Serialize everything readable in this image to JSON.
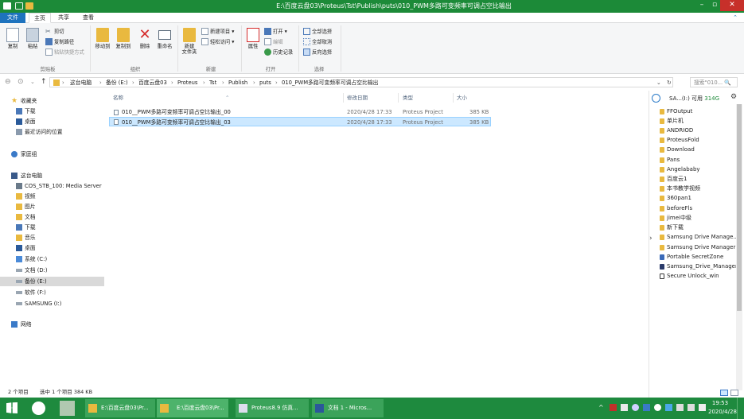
{
  "window": {
    "title": "E:\\百度云盘03\\Proteus\\Tst\\Publish\\puts\\010_PWM多路可变频率可调占空比输出"
  },
  "window_buttons": {
    "minimize": "–",
    "maximize": "▫",
    "close": "✕"
  },
  "tabs": [
    {
      "label": "文件"
    },
    {
      "label": "主页"
    },
    {
      "label": "共享"
    },
    {
      "label": "查看"
    }
  ],
  "ribbon": {
    "copy": "复制",
    "paste": "粘贴",
    "cut": "剪切",
    "copy_path": "复制路径",
    "paste_shortcut": "粘贴快捷方式",
    "move_to": "移动到",
    "copy_to": "复制到",
    "delete": "删除",
    "rename": "重命名",
    "new_folder_line1": "新建",
    "new_folder_line2": "文件夹",
    "new_item": "新建项目 ▾",
    "easy_access": "轻松访问 ▾",
    "properties": "属性",
    "open": "打开 ▾",
    "edit": "编辑",
    "history": "历史记录",
    "select_all": "全部选择",
    "select_none": "全部取消",
    "invert": "反向选择",
    "groups": {
      "clipboard": "剪贴板",
      "organize": "组织",
      "new": "新建",
      "open": "打开",
      "select": "选择"
    }
  },
  "address": {
    "crumbs": [
      "这台电脑",
      "备份 (E:)",
      "百度云盘03",
      "Proteus",
      "Tst",
      "Publish",
      "puts",
      "010_PWM多路可变频率可调占空比输出"
    ],
    "search_placeholder": "搜索\"010...  🔍"
  },
  "nav_pane": {
    "favorites": "收藏夹",
    "downloads": "下载",
    "desktop": "桌面",
    "recent": "最近访问的位置",
    "homegroup": "家庭组",
    "this_pc": "这台电脑",
    "pc_items": [
      "COS_STB_100: Media Server",
      "视频",
      "图片",
      "文档",
      "下载",
      "音乐",
      "桌面",
      "系统 (C:)",
      "文档 (D:)",
      "备份 (E:)",
      "软件 (F:)",
      "SAMSUNG (I:)"
    ],
    "network": "网络"
  },
  "columns": {
    "name": "名称",
    "date": "修改日期",
    "type": "类型",
    "size": "大小"
  },
  "files": [
    {
      "name": "010__PWM多路可变频率可调占空比输出_00",
      "date": "2020/4/28 17:33",
      "type": "Proteus Project",
      "size": "385 KB"
    },
    {
      "name": "010__PWM多路可变频率可调占空比输出_03",
      "date": "2020/4/28 17:33",
      "type": "Proteus Project",
      "size": "385 KB"
    }
  ],
  "right_pane": {
    "drive_label": "SA...(I:) 可用",
    "free": "314G",
    "items": [
      "FFOutput",
      "单片机",
      "ANDRIOD",
      "ProteusFold",
      "Download",
      "Pans",
      "Angelababy",
      "百度云1",
      "本书教学视频",
      "360pan1",
      "beforeFls",
      "jimei中级",
      "新下载",
      "Samsung Drive Manage...",
      "Samsung Drive Manager",
      "Portable SecretZone",
      "Samsung_Drive_Manager",
      "Secure Unlock_win"
    ]
  },
  "status": {
    "count": "2 个项目",
    "selection": "选中 1 个项目  384 KB"
  },
  "taskbar": {
    "items": [
      "E:\\百度云盘03\\Pr...",
      "E:\\百度云盘03\\Pr...",
      "Proteus8.9 仿真...",
      "文档 1 - Micros..."
    ],
    "time": "19:53",
    "date": "2020/4/28"
  },
  "colors": {
    "accent": "#1c8a38",
    "selection": "#cce8ff",
    "taskbar": "#1e8a3e"
  }
}
